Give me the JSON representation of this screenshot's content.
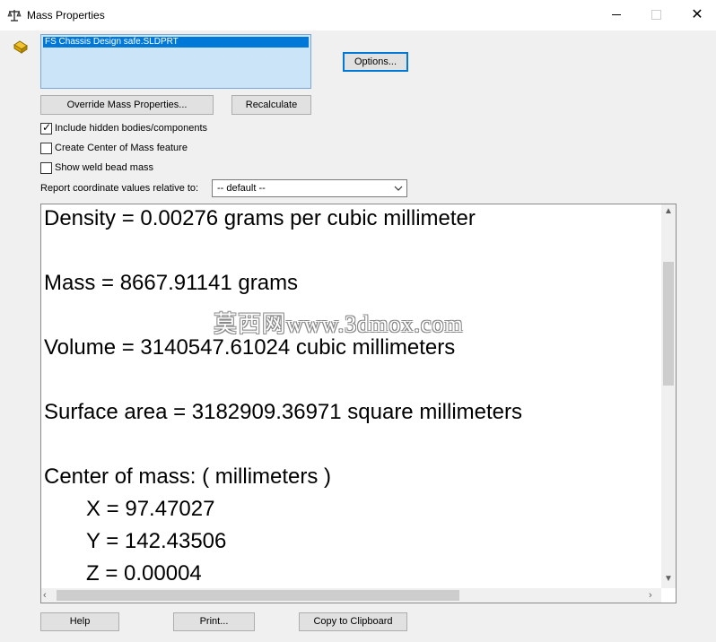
{
  "window": {
    "title": "Mass Properties",
    "icon": "scale-icon"
  },
  "selection": {
    "items": [
      "FS Chassis Design safe.SLDPRT"
    ],
    "part_icon": "part-icon"
  },
  "buttons": {
    "options": "Options...",
    "override": "Override Mass Properties...",
    "recalculate": "Recalculate",
    "help": "Help",
    "print": "Print...",
    "copy": "Copy to Clipboard"
  },
  "checkboxes": [
    {
      "label": "Include hidden bodies/components",
      "checked": true
    },
    {
      "label": "Create Center of Mass feature",
      "checked": false
    },
    {
      "label": "Show weld bead mass",
      "checked": false
    }
  ],
  "coordinates": {
    "label": "Report coordinate values relative to:",
    "selected": "-- default --"
  },
  "results": {
    "density": "Density = 0.00276 grams per cubic millimeter",
    "mass": "Mass = 8667.91141 grams",
    "volume": "Volume = 3140547.61024 cubic millimeters",
    "surface": "Surface area = 3182909.36971  square millimeters",
    "center_header": "Center of mass: ( millimeters )",
    "x": "X = 97.47027",
    "y": "Y = 142.43506",
    "z": "Z = 0.00004"
  },
  "watermark": "莫西网www.3dmox.com",
  "colors": {
    "selection_bg": "#cce4f7",
    "selection_highlight": "#0078d7",
    "button_bg": "#e1e1e1"
  }
}
